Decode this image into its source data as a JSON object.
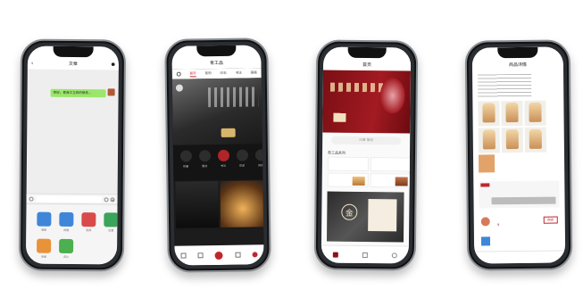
{
  "screens": {
    "chat": {
      "title": "文章",
      "message": "你好，青海工立邦的联系...",
      "actions": [
        {
          "label": "相册",
          "icon": "image-icon",
          "color": "#3f86d8"
        },
        {
          "label": "拍摄",
          "icon": "camera-icon",
          "color": "#3f86d8"
        },
        {
          "label": "视频",
          "icon": "video-icon",
          "color": "#d94b4b"
        },
        {
          "label": "位置",
          "icon": "location-icon",
          "color": "#3aa45a"
        },
        {
          "label": "收藏",
          "icon": "star-icon",
          "color": "#e8923a"
        },
        {
          "label": "名片",
          "icon": "card-icon",
          "color": "#4caf50"
        }
      ]
    },
    "mall": {
      "title": "青工品",
      "tabs": [
        "首页",
        "篆刻",
        "印石",
        "书法",
        "国画"
      ],
      "active_tab": "首页",
      "categories": [
        "印章",
        "篆刻",
        "书法",
        "印泥",
        "其他"
      ],
      "accent": "#c0272d"
    },
    "shop": {
      "title": "首页",
      "search_placeholder": "印章 篆刻",
      "section_title": "青工品系列",
      "brand_seal": "金",
      "accent": "#8c1219"
    },
    "detail": {
      "title": "商品详情",
      "price_button": "购买",
      "price_prefix": "¥",
      "accent": "#c0272d"
    }
  }
}
